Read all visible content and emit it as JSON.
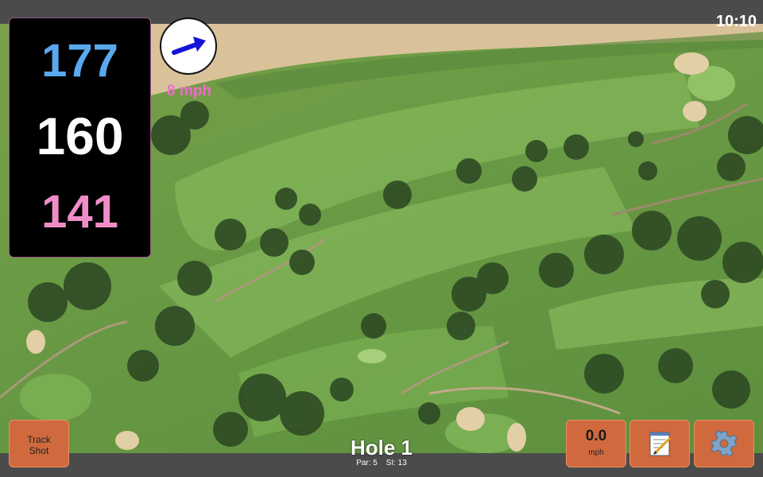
{
  "clock": "10:10",
  "distances": {
    "back": "177",
    "center": "160",
    "front": "141"
  },
  "wind": {
    "speed": "8 mph",
    "arrow_icon": "wind-arrow-icon"
  },
  "buttons": {
    "track_shot": [
      "Track",
      "Shot"
    ],
    "speed_value": "0.0",
    "speed_unit": "mph",
    "notes_icon": "notepad-icon",
    "settings_icon": "gear-icon"
  },
  "hole": {
    "title": "Hole 1",
    "par": "Par: 5",
    "si": "SI: 13"
  },
  "colors": {
    "back": "#5aa9ee",
    "center": "#ffffff",
    "front": "#f08dc7",
    "wind_text": "#f06ad0",
    "button": "#d06a3e"
  }
}
